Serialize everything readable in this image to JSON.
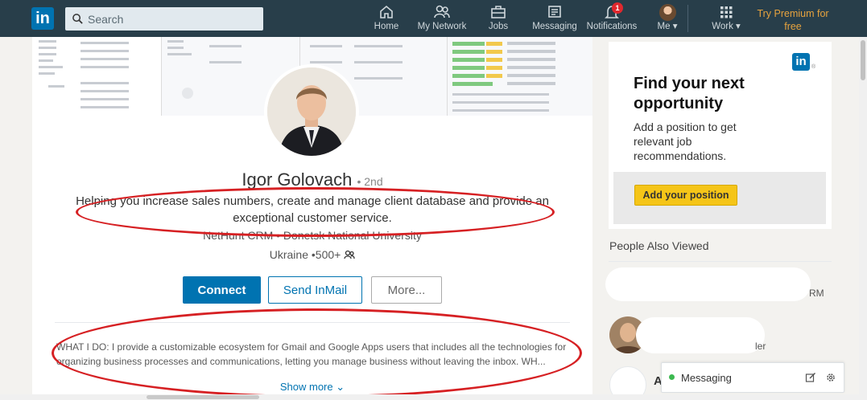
{
  "nav": {
    "logo_text": "in",
    "search_placeholder": "Search",
    "items": [
      {
        "label": "Home",
        "icon": "home-icon"
      },
      {
        "label": "My Network",
        "icon": "network-icon"
      },
      {
        "label": "Jobs",
        "icon": "briefcase-icon"
      },
      {
        "label": "Messaging",
        "icon": "messaging-icon"
      },
      {
        "label": "Notifications",
        "icon": "bell-icon",
        "badge": "1"
      },
      {
        "label": "Me",
        "icon": "avatar"
      },
      {
        "label": "Work",
        "icon": "grid-icon"
      }
    ],
    "premium_line1": "Try Premium for",
    "premium_line2": "free"
  },
  "profile": {
    "name": "Igor Golovach",
    "degree": "• 2nd",
    "headline": "Helping you increase sales numbers, create and manage client database and provide an exceptional customer service.",
    "company": "NetHunt CRM",
    "school": "Donetsk National University",
    "location": "Ukraine",
    "connections": "500+",
    "buttons": {
      "connect": "Connect",
      "inmail": "Send InMail",
      "more": "More..."
    },
    "summary": "WHAT I DO: I provide a customizable ecosystem for Gmail and Google Apps users that includes all the technologies for organizing business processes and communications, letting you manage business without leaving the inbox. WH...",
    "show_more": "Show more"
  },
  "ad": {
    "logo_text": "in",
    "title": "Find your next opportunity",
    "text": "Add a position to get relevant job recommendations.",
    "button": "Add your position"
  },
  "sidebar": {
    "people_also_viewed": "People Also Viewed",
    "snippets": [
      "RM",
      "ler",
      "A"
    ]
  },
  "messaging": {
    "label": "Messaging"
  },
  "colors": {
    "nav_bg": "#283e4a",
    "brand": "#0073b1",
    "premium": "#e7a33e",
    "annotation": "#d62023",
    "ad_button": "#f5c518"
  }
}
